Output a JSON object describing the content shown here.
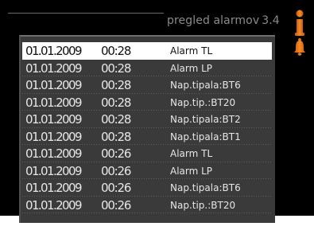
{
  "header": {
    "title": "pregled alarmov",
    "page_number": "3.4"
  },
  "colors": {
    "accent": "#f07a1a",
    "background": "#000000",
    "list_background": "#3a3a3a",
    "selected_row": "#ffffff"
  },
  "icons": {
    "info": "info-icon",
    "alarm": "bell-icon"
  },
  "alarm_log": {
    "columns": [
      "date",
      "time",
      "alarm"
    ],
    "rows": [
      {
        "date": "01.01.2009",
        "time": "00:28",
        "alarm": "Alarm TL"
      },
      {
        "date": "01.01.2009",
        "time": "00:28",
        "alarm": "Alarm LP"
      },
      {
        "date": "01.01.2009",
        "time": "00:28",
        "alarm": "Nap.tipala:BT6"
      },
      {
        "date": "01.01.2009",
        "time": "00:28",
        "alarm": "Nap.tip.:BT20"
      },
      {
        "date": "01.01.2009",
        "time": "00:28",
        "alarm": "Nap.tipala:BT2"
      },
      {
        "date": "01.01.2009",
        "time": "00:28",
        "alarm": "Nap.tipala:BT1"
      },
      {
        "date": "01.01.2009",
        "time": "00:26",
        "alarm": "Alarm TL"
      },
      {
        "date": "01.01.2009",
        "time": "00:26",
        "alarm": "Alarm LP"
      },
      {
        "date": "01.01.2009",
        "time": "00:26",
        "alarm": "Nap.tipala:BT6"
      },
      {
        "date": "01.01.2009",
        "time": "00:26",
        "alarm": "Nap.tip.:BT20"
      }
    ]
  }
}
